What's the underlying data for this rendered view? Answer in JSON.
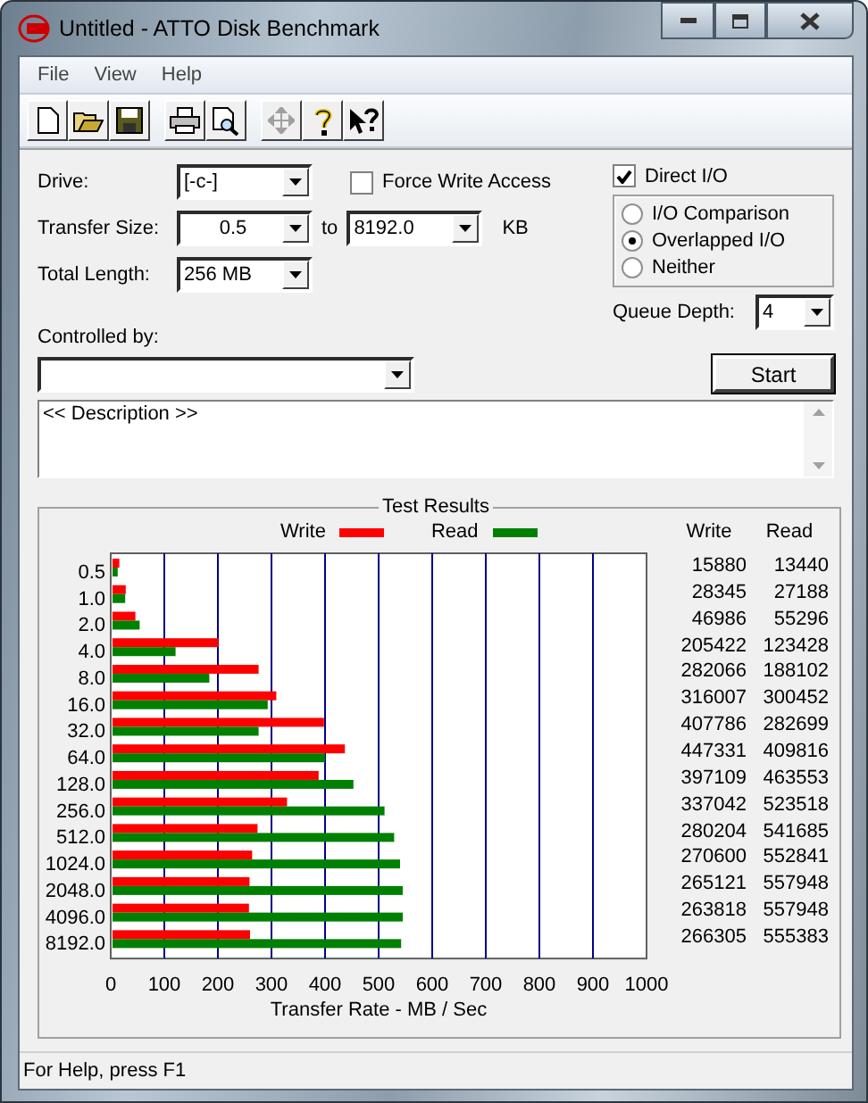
{
  "window": {
    "title": "Untitled - ATTO Disk Benchmark"
  },
  "menu": [
    "File",
    "View",
    "Help"
  ],
  "toolbar": [
    {
      "kind": "new",
      "disabled": false
    },
    {
      "kind": "open",
      "disabled": false
    },
    {
      "kind": "save",
      "disabled": false
    },
    {
      "kind": "print",
      "disabled": false
    },
    {
      "kind": "preview",
      "disabled": false
    },
    {
      "kind": "move",
      "disabled": true
    },
    {
      "kind": "help",
      "disabled": false
    },
    {
      "kind": "context_help",
      "disabled": false
    }
  ],
  "settings": {
    "drive": {
      "label": "Drive:",
      "value": "[-c-]"
    },
    "transfer_size": {
      "label": "Transfer Size:",
      "from": "0.5",
      "to_label": "to",
      "to": "8192.0",
      "unit": "KB"
    },
    "total_length": {
      "label": "Total Length:",
      "value": "256 MB"
    },
    "force_write_access": {
      "label": "Force Write Access",
      "checked": false
    },
    "direct_io": {
      "label": "Direct I/O",
      "checked": true
    },
    "io_modes": [
      {
        "label": "I/O Comparison",
        "selected": false
      },
      {
        "label": "Overlapped I/O",
        "selected": true
      },
      {
        "label": "Neither",
        "selected": false
      }
    ],
    "queue_depth": {
      "label": "Queue Depth:",
      "value": "4"
    },
    "controlled_by": {
      "label": "Controlled by:"
    },
    "start_button": "Start",
    "description": "<< Description >>"
  },
  "test_results": {
    "title": "Test Results",
    "columns": [
      "Write",
      "Read"
    ],
    "rows": [
      {
        "write": "15880",
        "read": "13440"
      },
      {
        "write": "28345",
        "read": "27188"
      },
      {
        "write": "46986",
        "read": "55296"
      },
      {
        "write": "205422",
        "read": "123428"
      },
      {
        "write": "282066",
        "read": "188102"
      },
      {
        "write": "316007",
        "read": "300452"
      },
      {
        "write": "407786",
        "read": "282699"
      },
      {
        "write": "447331",
        "read": "409816"
      },
      {
        "write": "397109",
        "read": "463553"
      },
      {
        "write": "337042",
        "read": "523518"
      },
      {
        "write": "280204",
        "read": "541685"
      },
      {
        "write": "270600",
        "read": "552841"
      },
      {
        "write": "265121",
        "read": "557948"
      },
      {
        "write": "263818",
        "read": "557948"
      },
      {
        "write": "266305",
        "read": "555383"
      }
    ],
    "chart_data": {
      "type": "bar",
      "orientation": "horizontal",
      "xlabel": "Transfer Rate - MB / Sec",
      "categories": [
        "0.5",
        "1.0",
        "2.0",
        "4.0",
        "8.0",
        "16.0",
        "32.0",
        "64.0",
        "128.0",
        "256.0",
        "512.0",
        "1024.0",
        "2048.0",
        "4096.0",
        "8192.0"
      ],
      "series": [
        {
          "name": "Write",
          "color": "#ff0000",
          "values": [
            16,
            28,
            46,
            201,
            276,
            309,
            398,
            437,
            388,
            329,
            274,
            264,
            259,
            258,
            260
          ]
        },
        {
          "name": "Read",
          "color": "#008000",
          "values": [
            13,
            27,
            54,
            121,
            184,
            293,
            276,
            400,
            453,
            511,
            529,
            540,
            545,
            545,
            542
          ]
        }
      ],
      "xlim": [
        0,
        1000
      ],
      "grid": true,
      "xticks": [
        0,
        100,
        200,
        300,
        400,
        500,
        600,
        700,
        800,
        900,
        1000
      ]
    }
  },
  "status_bar": "For Help, press F1"
}
